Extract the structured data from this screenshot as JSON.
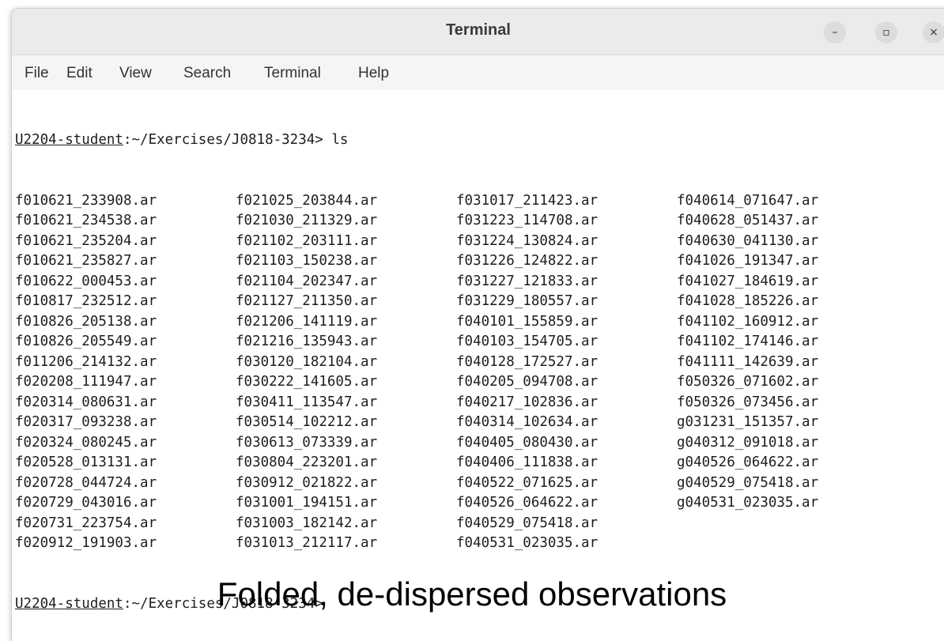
{
  "window": {
    "title": "Terminal",
    "controls": {
      "minimize": "–",
      "maximize": "▫",
      "close": "×"
    }
  },
  "menu": [
    "File",
    "Edit",
    "View",
    "Search",
    "Terminal",
    "Help"
  ],
  "terminal": {
    "prompt_user": "U2204-student",
    "prompt_path": ":~/Exercises/J0818-3234>",
    "command": " ls",
    "files": [
      [
        "f010621_233908.ar",
        "f021025_203844.ar",
        "f031017_211423.ar",
        "f040614_071647.ar"
      ],
      [
        "f010621_234538.ar",
        "f021030_211329.ar",
        "f031223_114708.ar",
        "f040628_051437.ar"
      ],
      [
        "f010621_235204.ar",
        "f021102_203111.ar",
        "f031224_130824.ar",
        "f040630_041130.ar"
      ],
      [
        "f010621_235827.ar",
        "f021103_150238.ar",
        "f031226_124822.ar",
        "f041026_191347.ar"
      ],
      [
        "f010622_000453.ar",
        "f021104_202347.ar",
        "f031227_121833.ar",
        "f041027_184619.ar"
      ],
      [
        "f010817_232512.ar",
        "f021127_211350.ar",
        "f031229_180557.ar",
        "f041028_185226.ar"
      ],
      [
        "f010826_205138.ar",
        "f021206_141119.ar",
        "f040101_155859.ar",
        "f041102_160912.ar"
      ],
      [
        "f010826_205549.ar",
        "f021216_135943.ar",
        "f040103_154705.ar",
        "f041102_174146.ar"
      ],
      [
        "f011206_214132.ar",
        "f030120_182104.ar",
        "f040128_172527.ar",
        "f041111_142639.ar"
      ],
      [
        "f020208_111947.ar",
        "f030222_141605.ar",
        "f040205_094708.ar",
        "f050326_071602.ar"
      ],
      [
        "f020314_080631.ar",
        "f030411_113547.ar",
        "f040217_102836.ar",
        "f050326_073456.ar"
      ],
      [
        "f020317_093238.ar",
        "f030514_102212.ar",
        "f040314_102634.ar",
        "g031231_151357.ar"
      ],
      [
        "f020324_080245.ar",
        "f030613_073339.ar",
        "f040405_080430.ar",
        "g040312_091018.ar"
      ],
      [
        "f020528_013131.ar",
        "f030804_223201.ar",
        "f040406_111838.ar",
        "g040526_064622.ar"
      ],
      [
        "f020728_044724.ar",
        "f030912_021822.ar",
        "f040522_071625.ar",
        "g040529_075418.ar"
      ],
      [
        "f020729_043016.ar",
        "f031001_194151.ar",
        "f040526_064622.ar",
        "g040531_023035.ar"
      ],
      [
        "f020731_223754.ar",
        "f031003_182142.ar",
        "f040529_075418.ar",
        ""
      ],
      [
        "f020912_191903.ar",
        "f031013_212117.ar",
        "f040531_023035.ar",
        ""
      ]
    ]
  },
  "caption": "Folded, de-dispersed observations"
}
